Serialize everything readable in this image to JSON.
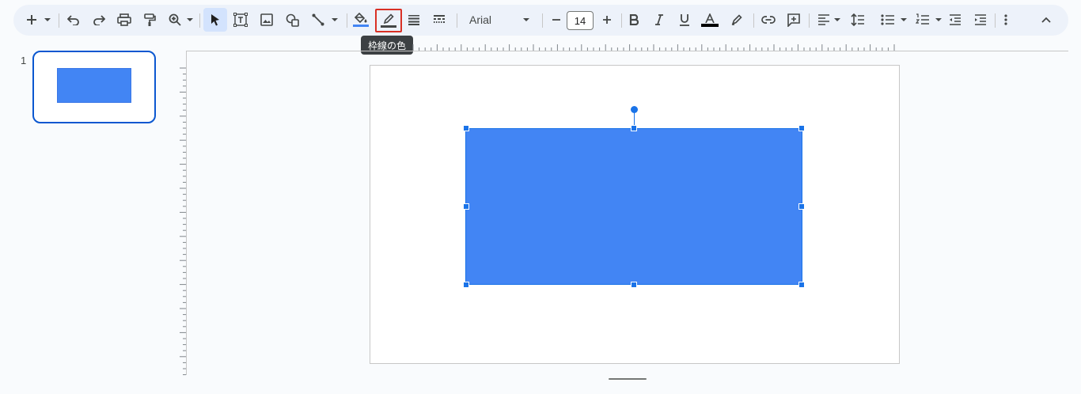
{
  "toolbar": {
    "tooltip": "枠線の色",
    "font_name": "Arial",
    "font_size": "14",
    "fill_color": "#4285f4",
    "border_color": "#444746",
    "text_color": "#000000",
    "icons": [
      "plus-icon",
      "undo-icon",
      "redo-icon",
      "print-icon",
      "paint-format-icon",
      "zoom-icon",
      "select-icon",
      "text-box-icon",
      "image-icon",
      "shapes-icon",
      "line-icon",
      "fill-color-icon",
      "border-color-icon",
      "border-weight-icon",
      "border-dash-icon",
      "decrease-font-icon",
      "increase-font-icon",
      "bold-icon",
      "italic-icon",
      "underline-icon",
      "text-color-icon",
      "highlight-icon",
      "link-icon",
      "comment-icon",
      "align-icon",
      "line-spacing-icon",
      "bulleted-list-icon",
      "numbered-list-icon",
      "decrease-indent-icon",
      "increase-indent-icon",
      "more-icon",
      "collapse-icon"
    ]
  },
  "filmstrip": {
    "slide_number": "1"
  },
  "slide": {
    "shape_color": "#4285f4",
    "selection_color": "#1a73e8"
  }
}
